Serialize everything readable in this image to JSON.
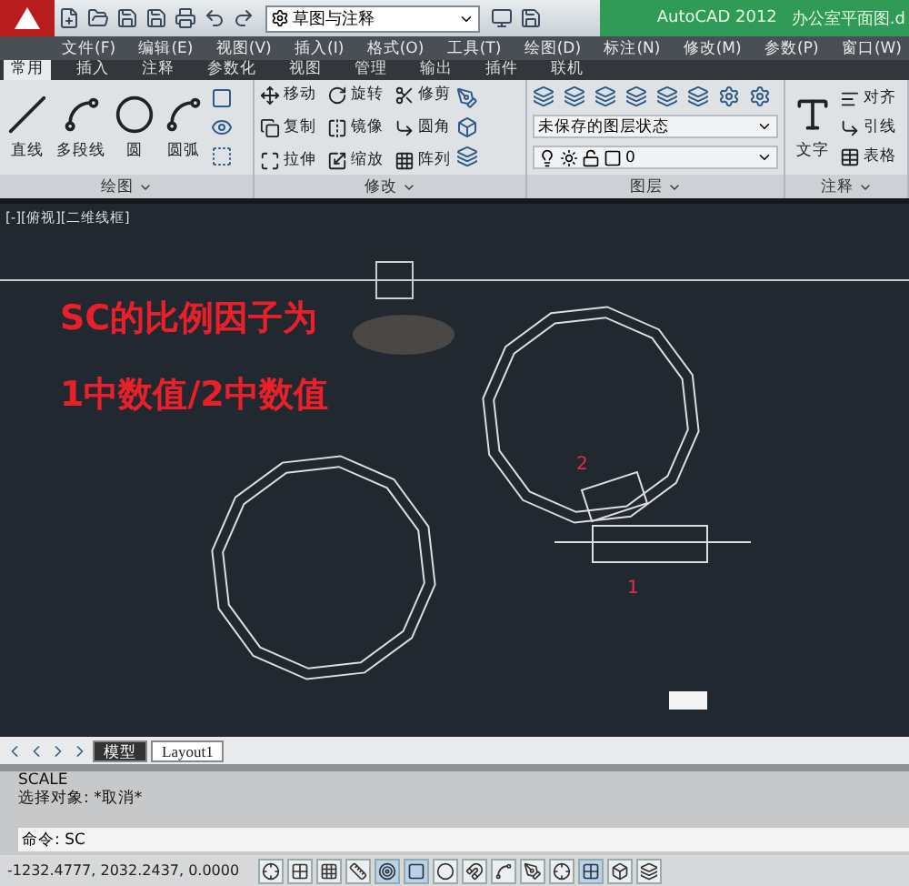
{
  "title_bar": {
    "workspace": "草图与注释",
    "app": "AutoCAD 2012",
    "file": "办公室平面图.d"
  },
  "menu_bar": [
    "文件(F)",
    "编辑(E)",
    "视图(V)",
    "插入(I)",
    "格式(O)",
    "工具(T)",
    "绘图(D)",
    "标注(N)",
    "修改(M)",
    "参数(P)",
    "窗口(W)"
  ],
  "ribbon_tabs": [
    {
      "label": "常用",
      "selected": true
    },
    {
      "label": "插入",
      "selected": false
    },
    {
      "label": "注释",
      "selected": false
    },
    {
      "label": "参数化",
      "selected": false
    },
    {
      "label": "视图",
      "selected": false
    },
    {
      "label": "管理",
      "selected": false
    },
    {
      "label": "输出",
      "selected": false
    },
    {
      "label": "插件",
      "selected": false
    },
    {
      "label": "联机",
      "selected": false
    }
  ],
  "panels": [
    {
      "title": "绘图",
      "large": [
        "直线",
        "多段线",
        "圆",
        "圆弧"
      ]
    },
    {
      "title": "修改",
      "small": [
        "移动",
        "旋转",
        "修剪",
        "复制",
        "镜像",
        "圆角",
        "拉伸",
        "缩放",
        "阵列"
      ]
    },
    {
      "title": "图层",
      "dropdowns": [
        "未保存的图层状态",
        "0"
      ]
    },
    {
      "title": "注释",
      "large": [
        "文字"
      ],
      "small": [
        "对齐",
        "引线",
        "表格"
      ]
    }
  ],
  "viewport": {
    "label": "[-][俯视][二维线框]",
    "annotations": [
      "SC的比例因子为",
      "1中数值/2中数值"
    ],
    "markers": [
      "2",
      "1"
    ]
  },
  "layout_tabs": [
    {
      "label": "模型",
      "selected": true
    },
    {
      "label": "Layout1",
      "selected": false
    }
  ],
  "command": {
    "history": [
      "SCALE",
      "选择对象: *取消*"
    ],
    "prompt": "命令: SC"
  },
  "status_bar": {
    "coordinates": "-1232.4777, 2032.2437, 0.0000"
  }
}
